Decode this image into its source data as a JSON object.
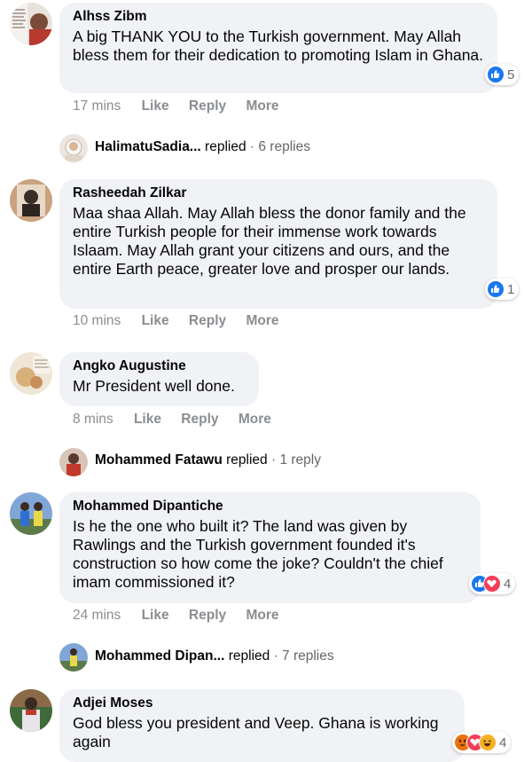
{
  "comments": [
    {
      "author": "Alhss Zibm",
      "text": "A big THANK YOU to the Turkish government. May Allah bless them for their dedication to promoting Islam in Ghana.",
      "time": "17 mins",
      "actions": [
        "Like",
        "Reply",
        "More"
      ],
      "reactions": {
        "types": [
          "like"
        ],
        "count": "5"
      }
    },
    {
      "author": "Rasheedah Zilkar",
      "text": "Maa shaa Allah. May Allah bless the donor family and the entire Turkish people for their immense work towards Islaam. May Allah grant your citizens and ours, and the entire Earth peace, greater love and prosper our lands.",
      "time": "10 mins",
      "actions": [
        "Like",
        "Reply",
        "More"
      ],
      "reactions": {
        "types": [
          "like"
        ],
        "count": "1"
      }
    },
    {
      "author": "Angko Augustine",
      "text": "Mr President well done.",
      "time": "8 mins",
      "actions": [
        "Like",
        "Reply",
        "More"
      ]
    },
    {
      "author": "Mohammed Dipantiche",
      "text": "Is he the one who built it? The land was given by Rawlings and the Turkish government founded it's construction so how come the joke? Couldn't the chief imam commissioned it?",
      "time": "24 mins",
      "actions": [
        "Like",
        "Reply",
        "More"
      ],
      "reactions": {
        "types": [
          "like",
          "love"
        ],
        "count": "4"
      }
    },
    {
      "author": "Adjei Moses",
      "text": "God bless you president and Veep. Ghana is working again",
      "reactions": {
        "types": [
          "angry",
          "love",
          "haha"
        ],
        "count": "4"
      }
    }
  ],
  "replies": [
    {
      "name": "HalimatuSadia...",
      "verb": "replied",
      "count": "· 6 replies"
    },
    {
      "name": "Mohammed Fatawu",
      "verb": "replied",
      "count": "· 1 reply"
    },
    {
      "name": "Mohammed Dipan...",
      "verb": "replied",
      "count": "· 7 replies"
    }
  ],
  "colors": {
    "like": "#1877f2",
    "love": "#f33e58",
    "angry": "#e9710f",
    "haha": "#f7b125",
    "bubble": "#f0f2f5",
    "meta": "#8a8d91"
  }
}
